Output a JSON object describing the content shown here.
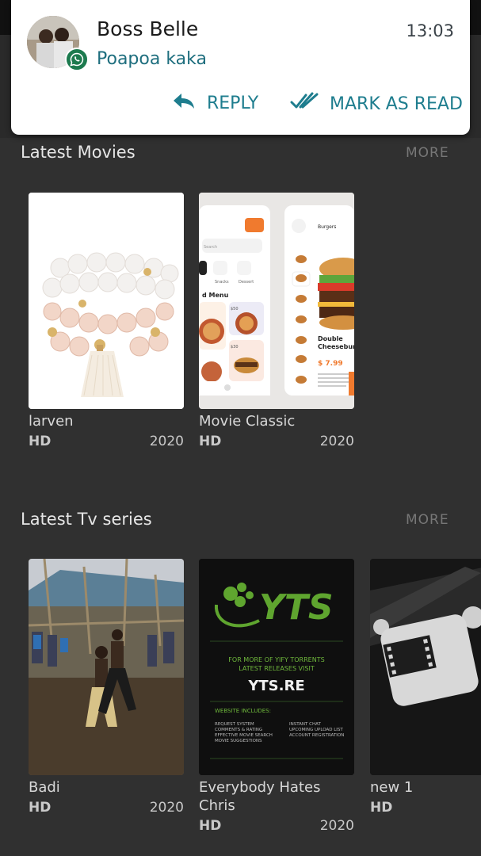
{
  "notification": {
    "sender": "Boss Belle",
    "time": "13:03",
    "message": "Poapoa kaka",
    "reply_label": "REPLY",
    "mark_read_label": "MARK AS READ",
    "app_icon": "whatsapp-icon",
    "accent_color": "#1e7d8e"
  },
  "sections": [
    {
      "title": "Latest Movies",
      "more_label": "MORE",
      "items": [
        {
          "title": "larven",
          "quality": "HD",
          "year": "2020"
        },
        {
          "title": "Movie Classic",
          "quality": "HD",
          "year": "2020"
        }
      ]
    },
    {
      "title": "Latest Tv series",
      "more_label": "MORE",
      "items": [
        {
          "title": "Badi",
          "quality": "HD",
          "year": "2020"
        },
        {
          "title": "Everybody Hates Chris",
          "quality": "HD",
          "year": "2020"
        },
        {
          "title": "new 1",
          "quality": "HD",
          "year": ""
        }
      ]
    }
  ],
  "posters": {
    "food_app": {
      "burgers": "Burgers",
      "search": "Search",
      "menu": "d Menu",
      "chip_prices": [
        "$50",
        "$30"
      ],
      "dish_line1": "Double",
      "dish_line2": "Cheeseburg",
      "price": "$ 7.99",
      "cats": [
        "Snacks",
        "Dessert"
      ]
    },
    "yts": {
      "logo": "YTS",
      "tagline1": "FOR MORE OF YIFY TORRENTS",
      "tagline2": "LATEST RELEASES VISIT",
      "url": "YTS.RE",
      "includes": "WEBSITE INCLUDES:",
      "features_left": [
        "REQUEST SYSTEM",
        "COMMENTS & RATING",
        "EFFECTIVE MOVIE SEARCH",
        "MOVIE SUGGESTIONS"
      ],
      "features_right": [
        "INSTANT CHAT",
        "UPCOMING UPLOAD LIST",
        "ACCOUNT REGISTRATION"
      ]
    }
  }
}
